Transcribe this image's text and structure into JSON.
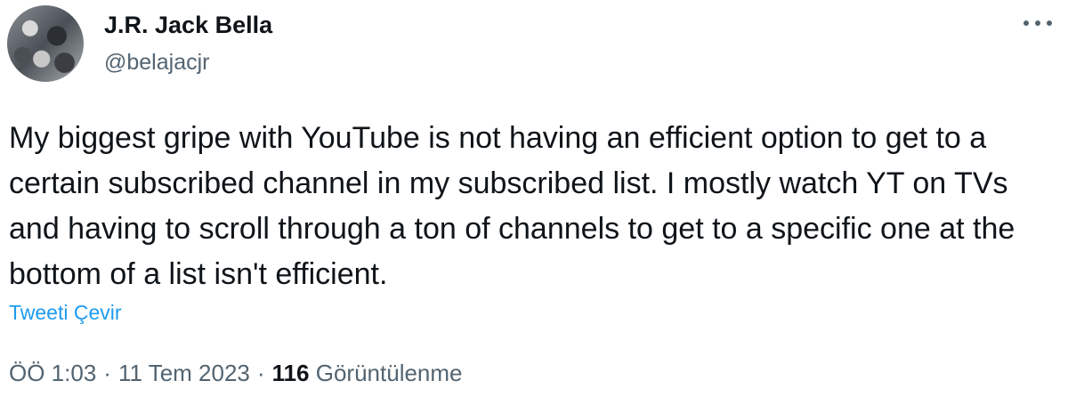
{
  "author": {
    "display_name": "J.R. Jack Bella",
    "handle": "@belajacjr"
  },
  "tweet": {
    "text": "My biggest gripe with YouTube is not having an efficient option to get to a certain subscribed channel in my subscribed list. I mostly watch YT on TVs and having to scroll through a ton of channels to get to a specific one at the bottom of a list isn't efficient.",
    "translate_label": "Tweeti Çevir"
  },
  "meta": {
    "time": "ÖÖ 1:03",
    "separator": "·",
    "date": "11 Tem 2023",
    "views_count": "116",
    "views_label": "Görüntülenme"
  },
  "icons": {
    "more": "more-horizontal-icon"
  },
  "colors": {
    "text": "#0f1419",
    "secondary": "#536471",
    "link": "#1d9bf0"
  }
}
